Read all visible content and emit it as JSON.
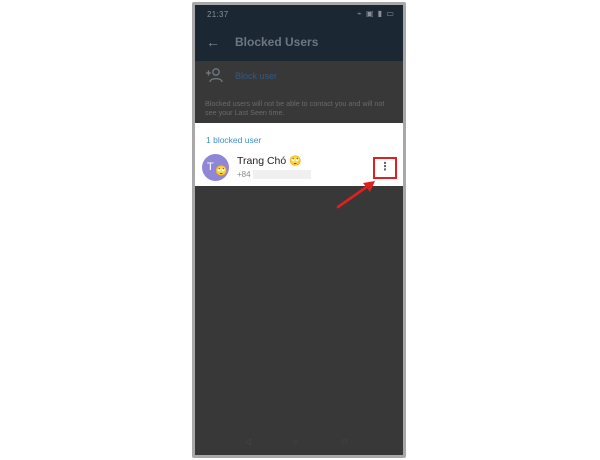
{
  "status_bar": {
    "time": "21:37",
    "icons": "⌁ ▣ ▮ ▭"
  },
  "app_bar": {
    "title": "Blocked Users",
    "back_icon": "←"
  },
  "block_action": {
    "label": "Block user",
    "icon": "add-user-icon"
  },
  "info": {
    "text": "Blocked users will not be able to contact you and will not see your Last Seen time."
  },
  "blocked_list": {
    "header": "1 blocked user",
    "users": [
      {
        "avatar_initial": "T",
        "avatar_emoji": "🙄",
        "name": "Trang Chó",
        "name_emoji": "🙄",
        "phone_prefix": "+84"
      }
    ]
  },
  "menu_button": {
    "glyph": "⋮"
  },
  "nav": {
    "back": "◁",
    "home": "○",
    "recent": "□"
  },
  "colors": {
    "annotation": "#e02020",
    "avatar": "#8f86d6",
    "accent": "#3d8fc9"
  }
}
